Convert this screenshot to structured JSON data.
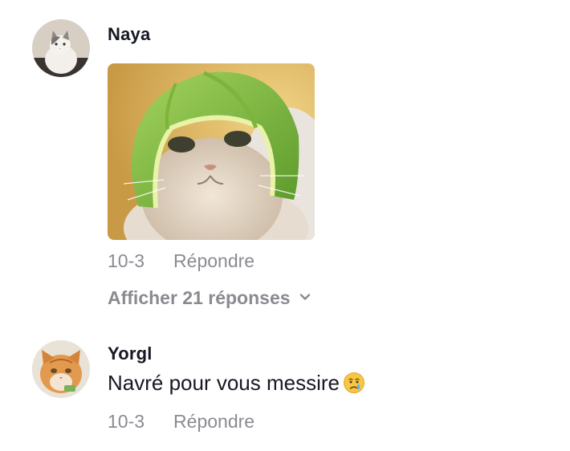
{
  "comments": [
    {
      "username": "Naya",
      "date": "10-3",
      "reply_label": "Répondre",
      "view_replies_label": "Afficher 21 réponses",
      "avatar_icon": "cat-avatar-icon",
      "attachment_icon": "cat-melon-helmet-image"
    },
    {
      "username": "Yorgl",
      "text": "Navré pour vous messire",
      "emoji": "crying-face-icon",
      "date": "10-3",
      "reply_label": "Répondre",
      "avatar_icon": "orange-cat-avatar-icon"
    }
  ],
  "colors": {
    "primary_text": "#161823",
    "secondary_text": "#8a8b91",
    "background": "#ffffff"
  }
}
